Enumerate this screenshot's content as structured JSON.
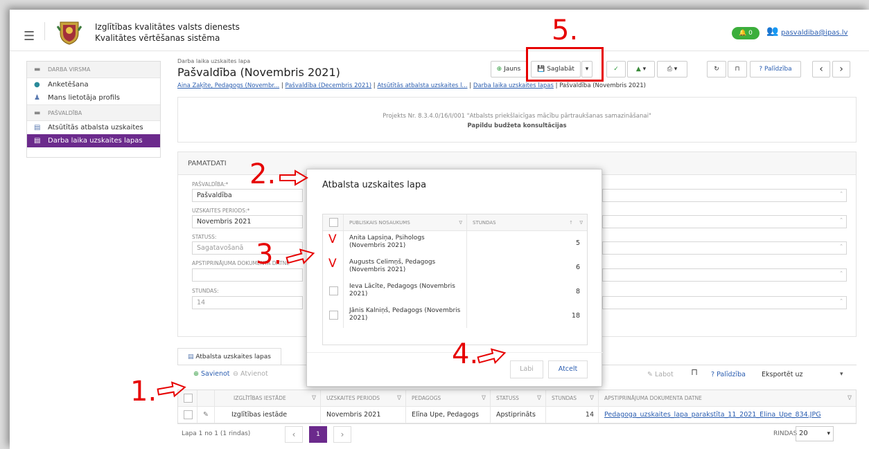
{
  "header": {
    "org_line1": "Izglītības kvalitātes valsts dienests",
    "org_line2": "Kvalitātes vērtēšanas sistēma",
    "notifications": "0",
    "user": "pasvaldiba@ipas.lv"
  },
  "sidebar": {
    "sections": [
      {
        "title": "DARBA VIRSMA",
        "items": [
          "Anketēšana",
          "Mans lietotāja profils"
        ]
      },
      {
        "title": "PAŠVALDĪBA",
        "items": [
          "Atsūtītās atbalsta uzskaites lapas",
          "Darba laika uzskaites lapas"
        ]
      }
    ]
  },
  "page": {
    "subtitle": "Darba laika uzskaites lapa",
    "title": "Pašvaldība (Novembris 2021)",
    "crumbs": [
      "Aina Zaķīte, Pedagogs (Novembr...",
      "Pašvaldība (Decembris 2021)",
      "Atsūtītās atbalsta uzskaites l...",
      "Darba laika uzskaites lapas"
    ],
    "crumb_current": "Pašvaldība (Novembris 2021)",
    "crumb_sep": " | "
  },
  "toolbar": {
    "new_label": "Jauns",
    "save_label": "Saglabāt",
    "help_label": "Palīdzība"
  },
  "info": {
    "project": "Projekts Nr. 8.3.4.0/16/I/001 \"Atbalsts priekšlaicīgas mācību pārtraukšanas samazināšanai\"",
    "budget": "Papildu budžeta konsultācijas"
  },
  "form": {
    "section_title": "PAMATDATI",
    "fields": [
      {
        "label": "PAŠVALDĪBA:*",
        "value": "Pašvaldība"
      },
      {
        "label": "UZSKAITES PERIODS:*",
        "value": "Novembris 2021"
      },
      {
        "label": "STATUSS:",
        "value": "Sagatavošanā"
      },
      {
        "label": "APSTIPRINĀJUMA DOKUMENTA DATNE",
        "value": ""
      },
      {
        "label": "STUNDAS:",
        "value": "14"
      }
    ]
  },
  "modal": {
    "title": "Atbalsta uzskaites lapa",
    "col_name": "PUBLISKAIS NOSAUKUMS",
    "col_hours": "STUNDAS",
    "rows": [
      {
        "name": "Anita Lapsiņa, Psihologs (Novembris 2021)",
        "hours": "5",
        "checked": true
      },
      {
        "name": "Augusts Celimņš, Pedagogs (Novembris 2021)",
        "hours": "6",
        "checked": true
      },
      {
        "name": "Ieva Lācīte, Pedagogs (Novembris 2021)",
        "hours": "8",
        "checked": false
      },
      {
        "name": "Jānis Kalniņš, Pedagogs (Novembris 2021)",
        "hours": "18",
        "checked": false
      }
    ],
    "check_mark": "V",
    "ok_label": "Labi",
    "cancel_label": "Atcelt"
  },
  "annotations": {
    "a1": "1.",
    "a2": "2.",
    "a3": "3.",
    "a4": "4.",
    "a5": "5."
  },
  "tab": {
    "label": "Atbalsta uzskaites lapas",
    "connect": "Savienot",
    "disconnect": "Atvienot",
    "edit": "Labot",
    "help": "Palīdzība",
    "export": "Eksportēt uz"
  },
  "grid": {
    "headers": [
      "IZGLĪTĪBAS IESTĀDE",
      "UZSKAITES PERIODS",
      "PEDAGOGS",
      "STATUSS",
      "STUNDAS",
      "APSTIPRINĀJUMA DOKUMENTA DATNE"
    ],
    "row": [
      "Izglītības iestāde",
      "Novembris 2021",
      "Elīna Upe, Pedagogs",
      "Apstiprināts",
      "14",
      "Pedagoga_uzskaites_lapa_parakstīta_11_2021_Elina_Upe_834.JPG"
    ]
  },
  "pager": {
    "info": "Lapa 1 no 1 (1 rindas)",
    "current": "1",
    "rows_label": "RINDAS",
    "rows_value": "20"
  },
  "colors": {
    "accent": "#6b2a8c",
    "annotation": "#e60000",
    "link": "#2a5db0",
    "notify": "#3cae3c"
  }
}
